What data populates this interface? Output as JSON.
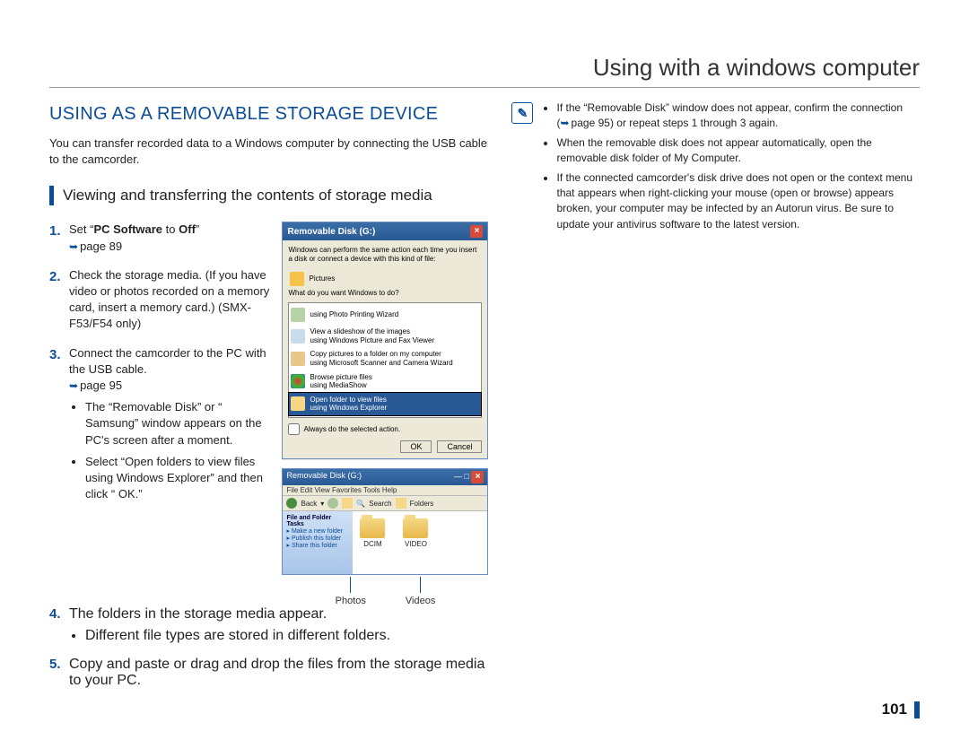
{
  "chapter_title": "Using with a windows computer",
  "section_title": "USING AS A REMOVABLE STORAGE DEVICE",
  "intro": "You can transfer recorded data to a Windows computer by connecting the USB cable to the camcorder.",
  "subhead": "Viewing and transferring the contents of storage media",
  "steps": {
    "s1_prefix": "Set “",
    "s1_bold": "PC Software",
    "s1_mid": " to ",
    "s1_bold2": "Off",
    "s1_suffix": "”",
    "s1_ref": "page 89",
    "s2": "Check the storage media. (If you have video or photos recorded on a memory card, insert a memory card.) (SMX-F53/F54 only)",
    "s3_main": "Connect the camcorder to the PC with the USB cable.",
    "s3_ref": "page 95",
    "s3_b1": "The “Removable Disk” or “ Samsung” window appears on the PC's screen after a moment.",
    "s3_b2": "Select “Open folders to view files using Windows Explorer” and then click “ OK.”",
    "s4_main": "The folders in the storage media appear.",
    "s4_b1": "Different file types are stored in different folders.",
    "s5": "Copy and paste or drag and drop the files from the storage media to your PC."
  },
  "notes": {
    "n1_a": "If the “Removable Disk” window does not appear, confirm the connection (",
    "n1_ref": "page 95",
    "n1_b": ") or repeat steps 1 through 3 again.",
    "n2": "When the removable disk does not appear automatically, open the removable disk folder of My Computer.",
    "n3": "If the connected camcorder's disk drive does not open or the context menu that appears when right-clicking your mouse (open or browse) appears broken, your computer may be infected by an Autorun virus. Be sure to update your antivirus software to the latest version."
  },
  "dialog": {
    "title": "Removable Disk (G:)",
    "prompt": "Windows can perform the same action each time you insert a disk or connect a device with this kind of file:",
    "type_label": "Pictures",
    "question": "What do you want Windows to do?",
    "opt1": "using Photo Printing Wizard",
    "opt2a": "View a slideshow of the images",
    "opt2b": "using Windows Picture and Fax Viewer",
    "opt3a": "Copy pictures to a folder on my computer",
    "opt3b": "using Microsoft Scanner and Camera Wizard",
    "opt4a": "Browse picture files",
    "opt4b": "using MediaShow",
    "opt5a": "Open folder to view files",
    "opt5b": "using Windows Explorer",
    "check": "Always do the selected action.",
    "ok": "OK",
    "cancel": "Cancel"
  },
  "explorer": {
    "title": "Removable Disk (G:)",
    "menu": "File  Edit  View  Favorites  Tools  Help",
    "back": "Back",
    "search": "Search",
    "folders": "Folders",
    "side_head": "File and Folder Tasks",
    "side_a": "Make a new folder",
    "side_b": "Publish this folder",
    "side_c": "Share this folder",
    "folder1": "DCIM",
    "folder2": "VIDEO"
  },
  "callouts": {
    "photos": "Photos",
    "videos": "Videos"
  },
  "page_number": "101"
}
